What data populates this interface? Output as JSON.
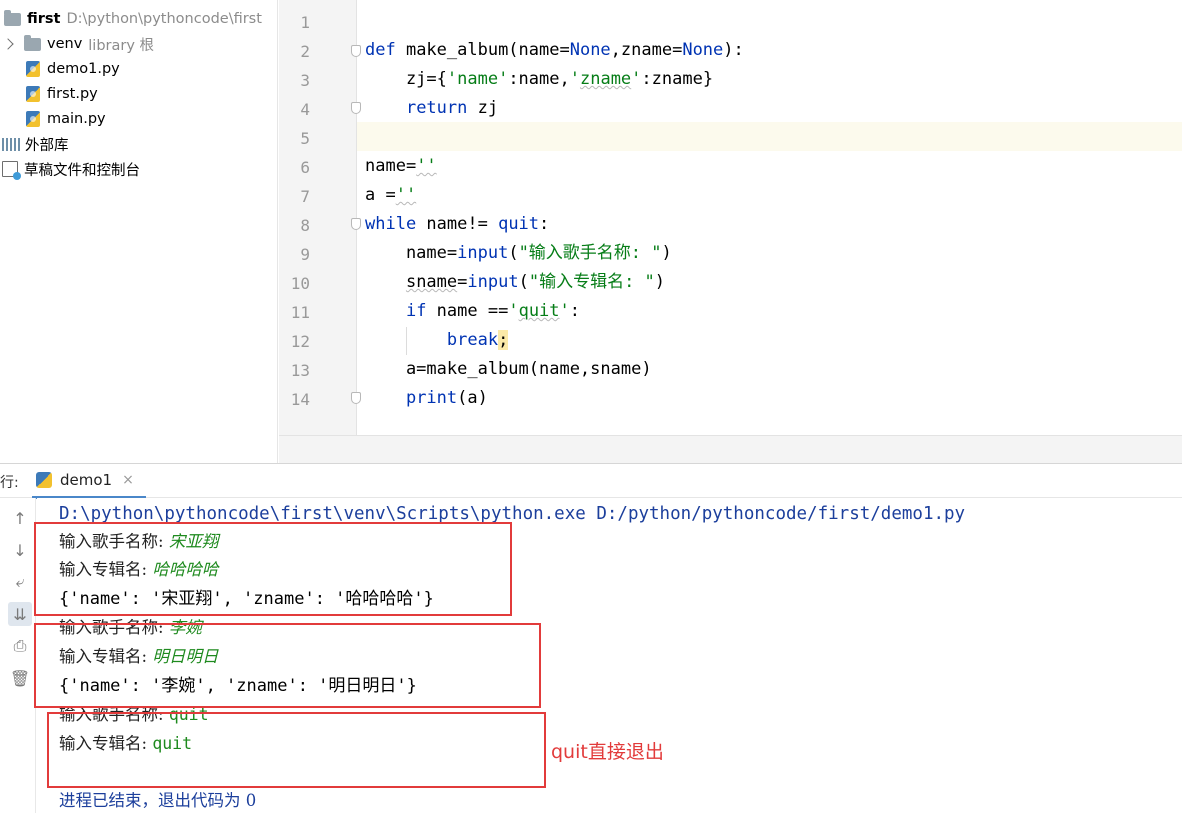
{
  "project": {
    "root": {
      "name": "first",
      "path": "D:\\python\\pythoncode\\first"
    },
    "venv": {
      "name": "venv",
      "tag": "library 根"
    },
    "files": [
      "demo1.py",
      "first.py",
      "main.py"
    ],
    "external_libraries": "外部库",
    "scratches": "草稿文件和控制台"
  },
  "editor": {
    "line_numbers": [
      "1",
      "2",
      "3",
      "4",
      "5",
      "6",
      "7",
      "8",
      "9",
      "10",
      "11",
      "12",
      "13",
      "14"
    ]
  },
  "run": {
    "prefix": "行:",
    "tab_label": "demo1",
    "tab_close": "×",
    "toolbar_icons": [
      "arrow-up-icon",
      "arrow-down-icon",
      "soft-wrap-icon",
      "scroll-to-end-icon",
      "print-icon",
      "trash-icon"
    ]
  },
  "console": {
    "command": "D:\\python\\pythoncode\\first\\venv\\Scripts\\python.exe D:/python/pythoncode/first/demo1.py",
    "prompt_singer": "输入歌手名称: ",
    "prompt_album": "输入专辑名: ",
    "run1": {
      "singer": "宋亚翔",
      "album": "哈哈哈哈",
      "output": "{'name': '宋亚翔', 'zname': '哈哈哈哈'}"
    },
    "run2": {
      "singer": "李婉",
      "album": "明日明日",
      "output": "{'name': '李婉', 'zname': '明日明日'}"
    },
    "run3": {
      "singer": "quit",
      "album": "quit"
    },
    "exit_message": "进程已结束，退出代码为 0"
  },
  "annotation": {
    "note": "quit直接退出",
    "color": "#e23b3b"
  }
}
